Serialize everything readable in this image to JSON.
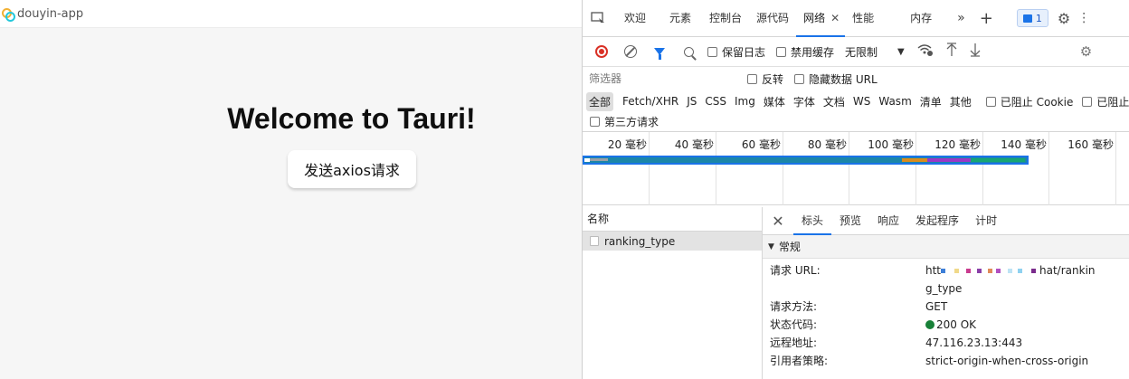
{
  "app": {
    "title": "douyin-app",
    "heading": "Welcome to Tauri!",
    "button_label": "发送axios请求"
  },
  "devtools": {
    "tabs": [
      {
        "label": "欢迎"
      },
      {
        "label": "元素"
      },
      {
        "label": "控制台"
      },
      {
        "label": "源代码"
      },
      {
        "label": "网络",
        "active": true
      },
      {
        "label": "性能"
      },
      {
        "label": "内存"
      }
    ],
    "issues_count": "1",
    "toolbar": {
      "preserve_log": "保留日志",
      "disable_cache": "禁用缓存",
      "throttle": "无限制"
    },
    "filter": {
      "placeholder": "筛选器",
      "invert": "反转",
      "hide_data_urls": "隐藏数据 URL"
    },
    "types": [
      "全部",
      "Fetch/XHR",
      "JS",
      "CSS",
      "Img",
      "媒体",
      "字体",
      "文档",
      "WS",
      "Wasm",
      "清单",
      "其他"
    ],
    "blocked_cookies": "已阻止 Cookie",
    "blocked_requests": "已阻止请",
    "third_party": "第三方请求",
    "timeline_ticks": [
      "20  毫秒",
      "40  毫秒",
      "60  毫秒",
      "80  毫秒",
      "100  毫秒",
      "120  毫秒",
      "140  毫秒",
      "160  毫秒"
    ],
    "waterfall_colors": {
      "main": "#1b86a8",
      "queue": "#9aa0a6",
      "wait": "#d98c1f",
      "receive": "#9b38c7",
      "download": "#17a673",
      "frame": "#1a73e8"
    },
    "name_column_header": "名称",
    "requests": [
      {
        "name": "ranking_type"
      }
    ],
    "detail_tabs": [
      "标头",
      "预览",
      "响应",
      "发起程序",
      "计时"
    ],
    "general_section": "常规",
    "general": {
      "request_url_label": "请求 URL:",
      "request_url_prefix": "htt",
      "request_url_suffix": "hat/rankin",
      "request_url_tail": "g_type",
      "method_label": "请求方法:",
      "method": "GET",
      "status_label": "状态代码:",
      "status": "200 OK",
      "remote_label": "远程地址:",
      "remote": "47.116.23.13:443",
      "referrer_label": "引用者策略:",
      "referrer": "strict-origin-when-cross-origin"
    }
  }
}
